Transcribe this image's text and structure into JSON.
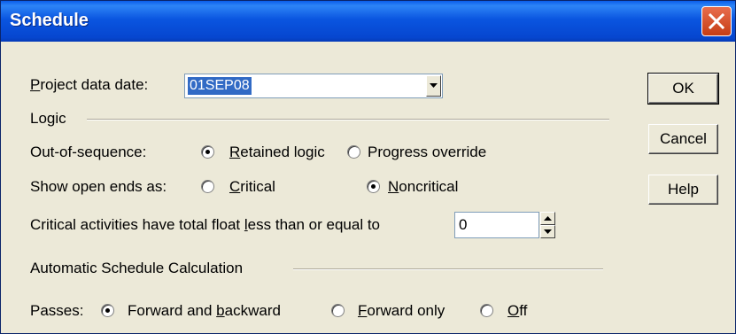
{
  "window": {
    "title": "Schedule"
  },
  "data_date": {
    "label_pre": "P",
    "label_rest": "roject data date:",
    "value": "01SEP08"
  },
  "logic": {
    "group_label": "Logic",
    "out_of_sequence_label": "Out-of-sequence:",
    "retained": {
      "u": "R",
      "rest": "etained logic",
      "selected": true
    },
    "progress": {
      "label": "Progress override",
      "selected": false
    },
    "open_ends_label": "Show open ends as:",
    "critical": {
      "u": "C",
      "rest": "ritical",
      "selected": false
    },
    "noncritical": {
      "u": "N",
      "rest": "oncritical",
      "selected": true
    },
    "float_label_pre": "Critical activities have total float ",
    "float_label_u": "l",
    "float_label_post": "ess than or equal to",
    "float_value": "0"
  },
  "auto": {
    "group_label": "Automatic Schedule Calculation",
    "passes_label": "Passes:",
    "fwd_back": {
      "pre": "Forward and ",
      "u": "b",
      "post": "ackward",
      "selected": true
    },
    "fwd_only": {
      "u": "F",
      "rest": "orward only",
      "selected": false
    },
    "off": {
      "u": "O",
      "rest": "ff",
      "selected": false
    }
  },
  "buttons": {
    "ok": "OK",
    "cancel": "Cancel",
    "help": "Help"
  },
  "colors": {
    "titlebar": "#0a55e0",
    "dialog_bg": "#ece9d8",
    "selection": "#316ac5",
    "close": "#d84a22"
  },
  "icons": [
    "close-icon",
    "dropdown-arrow-icon",
    "spin-up-icon",
    "spin-down-icon"
  ]
}
